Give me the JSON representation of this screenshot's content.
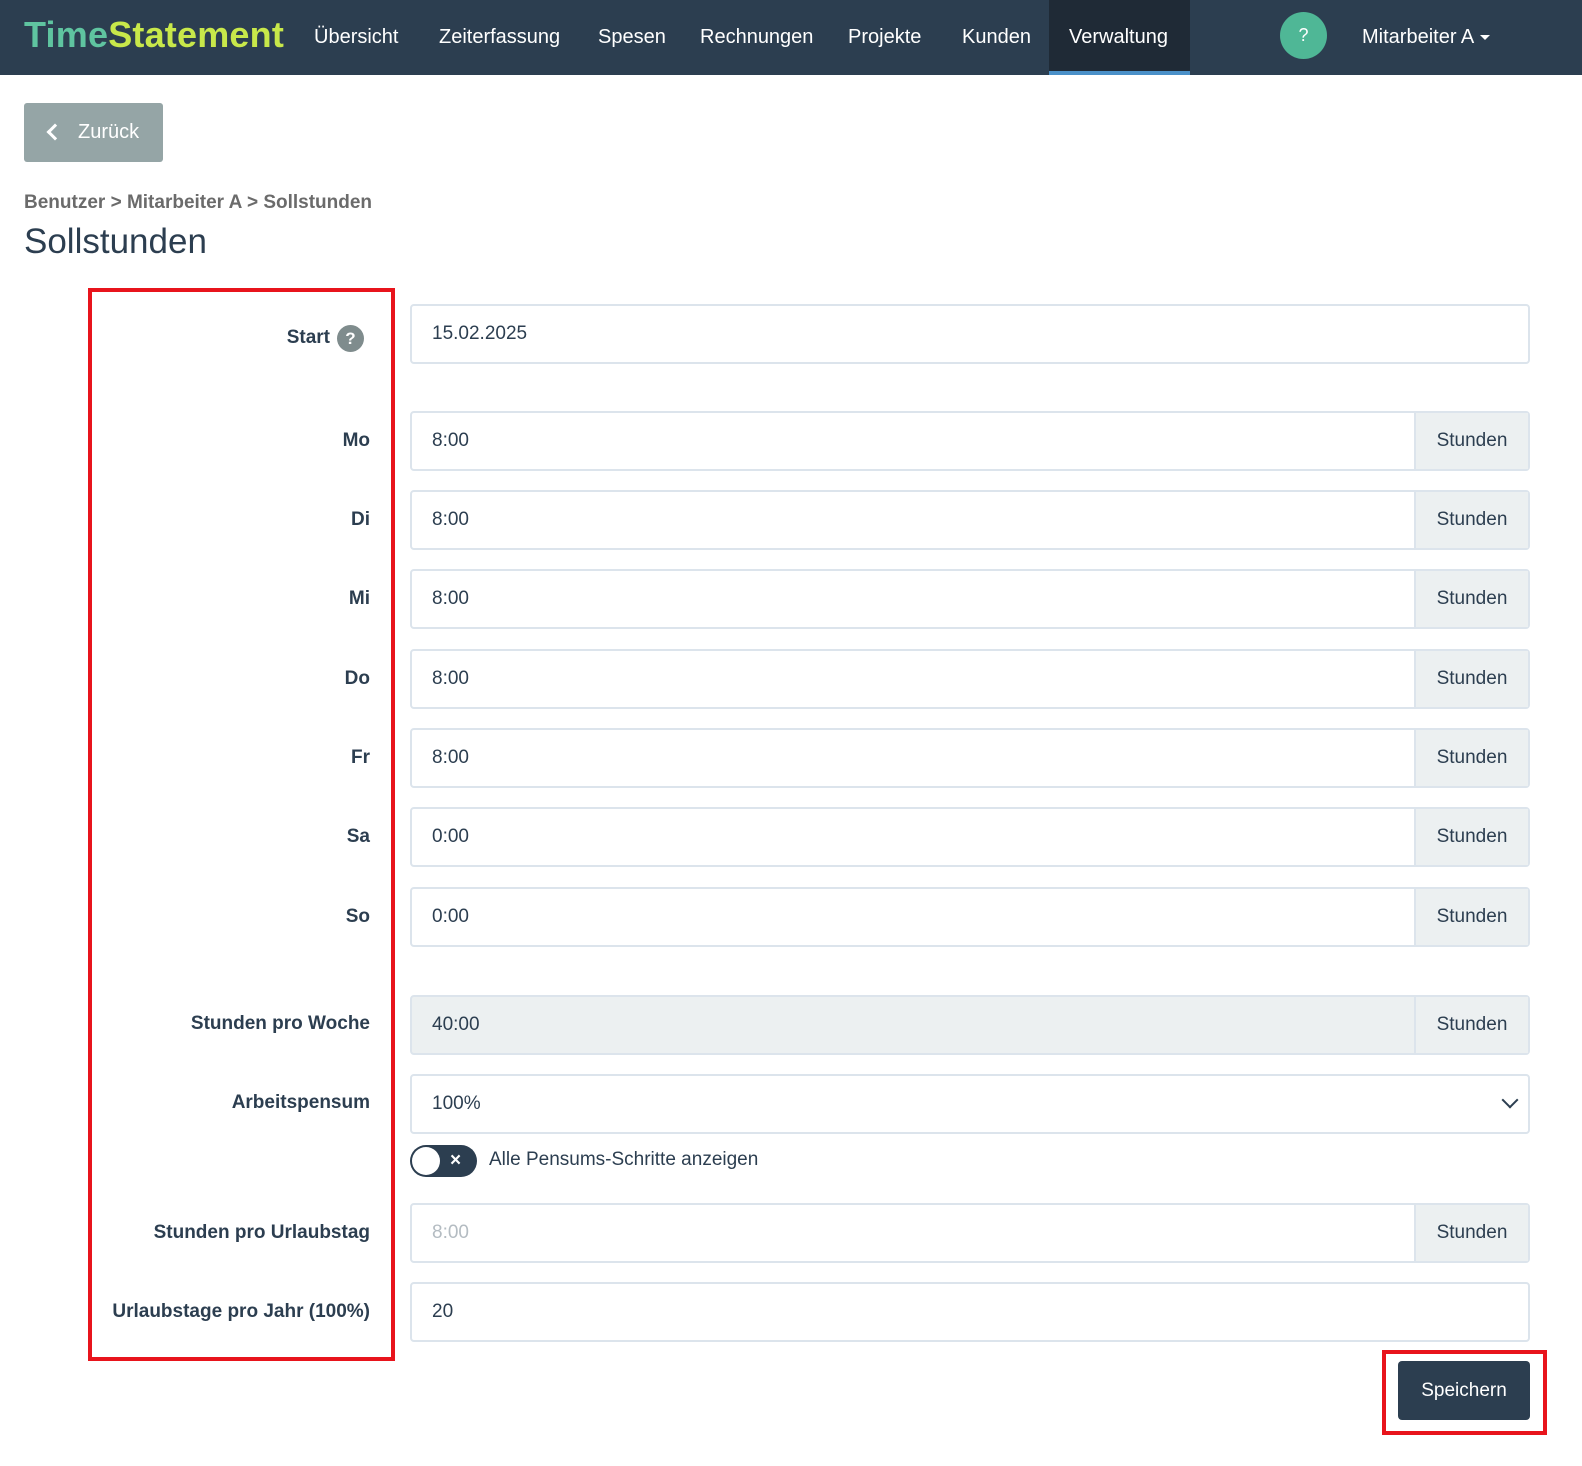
{
  "app": {
    "brand_part1": "Time",
    "brand_part2": "Statement"
  },
  "nav": {
    "items": [
      "Übersicht",
      "Zeiterfassung",
      "Spesen",
      "Rechnungen",
      "Projekte",
      "Kunden",
      "Verwaltung"
    ],
    "active": "Verwaltung",
    "help": "?",
    "user": "Mitarbeiter A"
  },
  "back_button": "Zurück",
  "breadcrumb": "Benutzer > Mitarbeiter A > Sollstunden",
  "page_title": "Sollstunden",
  "form": {
    "start": {
      "label": "Start",
      "help": "?",
      "value": "15.02.2025"
    },
    "days": [
      {
        "label": "Mo",
        "value": "8:00"
      },
      {
        "label": "Di",
        "value": "8:00"
      },
      {
        "label": "Mi",
        "value": "8:00"
      },
      {
        "label": "Do",
        "value": "8:00"
      },
      {
        "label": "Fr",
        "value": "8:00"
      },
      {
        "label": "Sa",
        "value": "0:00"
      },
      {
        "label": "So",
        "value": "0:00"
      }
    ],
    "unit": "Stunden",
    "hours_per_week": {
      "label": "Stunden pro Woche",
      "value": "40:00"
    },
    "workload": {
      "label": "Arbeitspensum",
      "value": "100%"
    },
    "toggle": {
      "label": "Alle Pensums-Schritte anzeigen",
      "state": "off",
      "icon": "×"
    },
    "hours_per_vacation_day": {
      "label": "Stunden pro Urlaubstag",
      "placeholder": "8:00"
    },
    "vacation_days_per_year": {
      "label": "Urlaubstage pro Jahr (100%)",
      "value": "20"
    }
  },
  "save_button": "Speichern",
  "colors": {
    "navbar": "#2c3e50",
    "brand_green": "#5fc4a0",
    "brand_lime": "#c8e84a",
    "highlight": "#e8141c"
  }
}
